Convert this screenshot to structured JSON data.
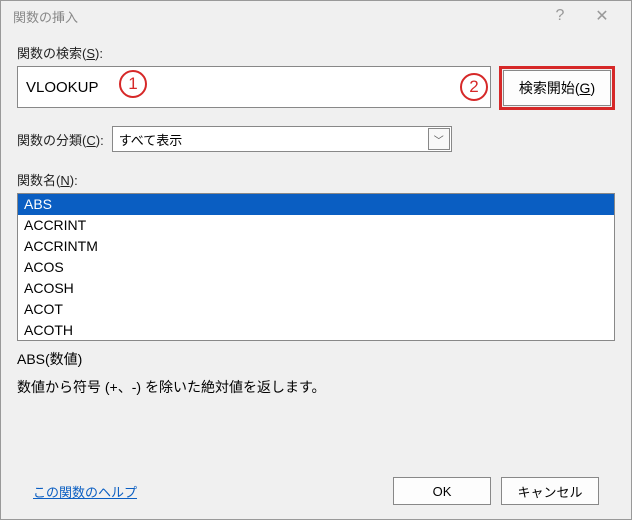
{
  "titlebar": {
    "title": "関数の挿入"
  },
  "search": {
    "label_pre": "関数の検索(",
    "label_key": "S",
    "label_post": "):",
    "value": "VLOOKUP",
    "button_pre": "検索開始(",
    "button_key": "G",
    "button_post": ")"
  },
  "callouts": {
    "one": "1",
    "two": "2"
  },
  "category": {
    "label_pre": "関数の分類(",
    "label_key": "C",
    "label_post": "):",
    "selected": "すべて表示"
  },
  "functions": {
    "label_pre": "関数名(",
    "label_key": "N",
    "label_post": "):",
    "items": [
      "ABS",
      "ACCRINT",
      "ACCRINTM",
      "ACOS",
      "ACOSH",
      "ACOT",
      "ACOTH"
    ]
  },
  "detail": {
    "syntax": "ABS(数値)",
    "description": "数値から符号 (+、-) を除いた絶対値を返します。"
  },
  "footer": {
    "help": "この関数のヘルプ",
    "ok": "OK",
    "cancel": "キャンセル"
  }
}
